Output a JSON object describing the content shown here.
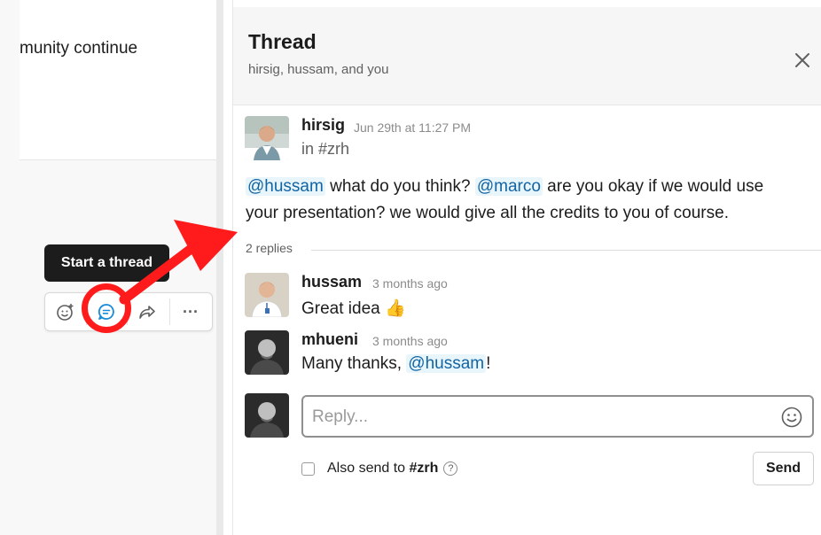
{
  "left": {
    "message_fragment": "munity continue",
    "tooltip": "Start a thread",
    "actions": {
      "reaction_icon": "add-reaction-icon",
      "thread_icon": "thread-icon",
      "share_icon": "share-icon",
      "more_label": "···"
    }
  },
  "thread": {
    "title": "Thread",
    "participants": "hirsig, hussam, and you",
    "original": {
      "name": "hirsig",
      "time": "Jun 29th at 11:27 PM",
      "channel": "in #zrh",
      "mention1": "@hussam",
      "text1": " what do you think? ",
      "mention2": "@marco",
      "text2": " are you okay if we would use",
      "text3": "your presentation? we would give all the credits to you of course."
    },
    "replies_label": "2 replies",
    "replies": [
      {
        "name": "hussam",
        "time": "3 months ago",
        "text": "Great idea",
        "emoji": "👍"
      },
      {
        "name": "mhueni",
        "time": "3 months ago",
        "text_before": "Many thanks, ",
        "mention": "@hussam",
        "text_after": "!"
      }
    ],
    "composer": {
      "placeholder": "Reply...",
      "also_send_prefix": "Also send to ",
      "also_send_channel": "#zrh",
      "help_glyph": "?",
      "send_label": "Send"
    }
  },
  "colors": {
    "annotation_red": "#ff1b1b",
    "mention_blue": "#1264a3",
    "mention_bg": "#e8f5fa"
  }
}
